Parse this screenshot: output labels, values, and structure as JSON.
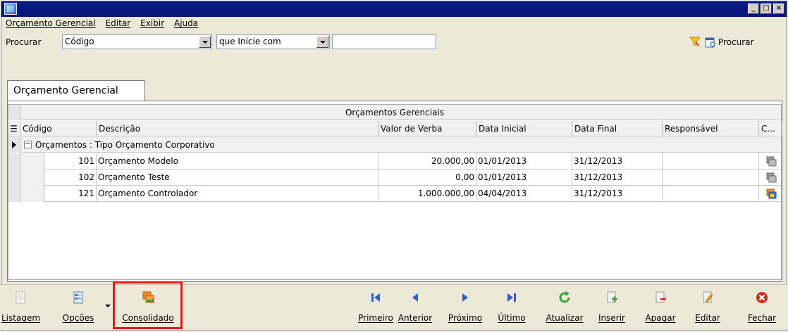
{
  "window": {
    "title": ""
  },
  "menu": {
    "items": [
      "Orçamento Gerencial",
      "Editar",
      "Exibir",
      "Ajuda"
    ]
  },
  "search": {
    "label": "Procurar",
    "field_value": "Código",
    "condition_value": "que Inicie com",
    "text_value": "",
    "button_label": "Procurar"
  },
  "tab": {
    "label": "Orçamento Gerencial"
  },
  "grid": {
    "group_header": "Orçamentos Gerenciais",
    "columns": [
      "Código",
      "Descrição",
      "Valor de Verba",
      "Data Inicial",
      "Data Final",
      "Responsável",
      "C..."
    ],
    "group_row": "Orçamentos : Tipo Orçamento Corporativo",
    "rows": [
      {
        "codigo": "101",
        "descricao": "Orçamento Modelo",
        "valor": "20.000,00",
        "data_inicial": "01/01/2013",
        "data_final": "31/12/2013",
        "responsavel": "",
        "icon": "consolidation-gray-icon"
      },
      {
        "codigo": "102",
        "descricao": "Orçamento Teste",
        "valor": "0,00",
        "data_inicial": "01/01/2013",
        "data_final": "31/12/2013",
        "responsavel": "",
        "icon": "consolidation-gray-icon"
      },
      {
        "codigo": "121",
        "descricao": "Orçamento Controlador",
        "valor": "1.000.000,00",
        "data_inicial": "04/04/2013",
        "data_final": "31/12/2013",
        "responsavel": "",
        "icon": "consolidation-color-icon"
      }
    ]
  },
  "toolbar": {
    "listagem": "Listagem",
    "opcoes": "Opções",
    "consolidado": "Consolidado",
    "primeiro": "Primeiro",
    "anterior": "Anterior",
    "proximo": "Próximo",
    "ultimo": "Último",
    "atualizar": "Atualizar",
    "inserir": "Inserir",
    "apagar": "Apagar",
    "editar": "Editar",
    "fechar": "Fechar"
  },
  "colors": {
    "titlebar": "#0b1a8c",
    "nav_blue": "#2f5fc4",
    "refresh_green": "#3aa23a",
    "close_red": "#d42a1e",
    "highlight_red": "#e01b1b"
  }
}
